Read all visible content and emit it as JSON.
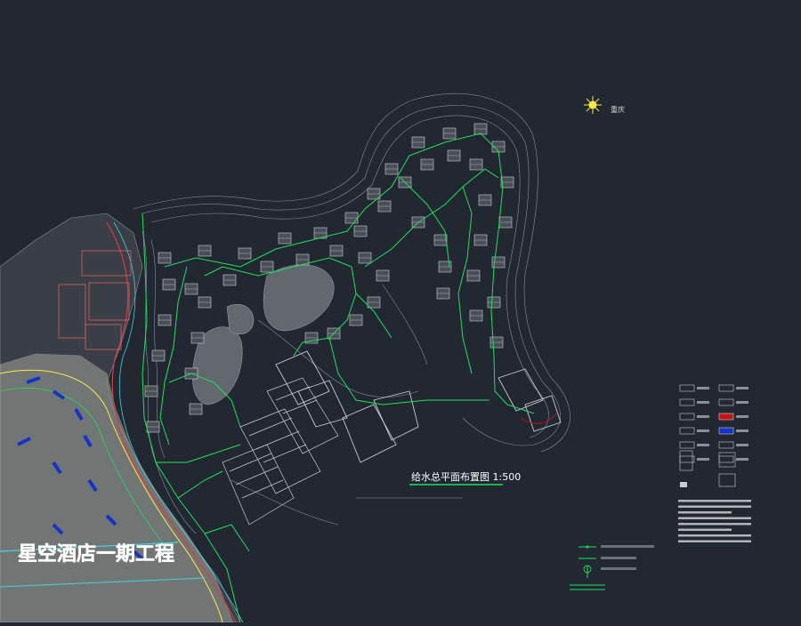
{
  "drawing": {
    "title": "给水总平面布置图 1:500",
    "site_label": "星空酒店一期工程",
    "north_label": "重庆"
  },
  "colors": {
    "background": "#212831",
    "pipe": "#22e05a",
    "building": "#c9ccd2",
    "contour": "#8a9099",
    "title_underline": "#22e05a",
    "north": "#ffe84a",
    "legend_blue": "#1434c8",
    "legend_red": "#c81414",
    "site_label": "#ffffff"
  },
  "legend": {
    "rows": 6
  },
  "notes": {
    "lines": 8
  }
}
